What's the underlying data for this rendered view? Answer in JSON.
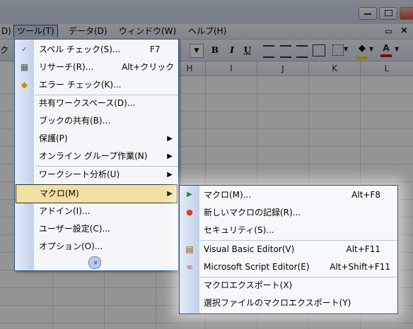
{
  "menubar": {
    "items": [
      "D)",
      "ツール(T)",
      "データ(D)",
      "ウィンドウ(W)",
      "ヘルプ(H)"
    ]
  },
  "toolbar": {
    "bold": "B",
    "italic": "I",
    "underline": "U",
    "font_color_glyph": "A"
  },
  "columns": [
    "H",
    "I",
    "J",
    "K",
    "L"
  ],
  "tools_menu": {
    "items": [
      {
        "label": "スペル チェック(S)...",
        "shortcut": "F7",
        "icon": "spellcheck-icon"
      },
      {
        "label": "リサーチ(R)...",
        "shortcut": "Alt+クリック",
        "icon": "research-icon"
      },
      {
        "label": "エラー チェック(K)...",
        "shortcut": "",
        "icon": "error-check-icon"
      },
      {
        "label": "共有ワークスペース(D)...",
        "shortcut": ""
      },
      {
        "label": "ブックの共有(B)...",
        "shortcut": ""
      },
      {
        "label": "保護(P)",
        "shortcut": "",
        "submenu": true
      },
      {
        "label": "オンライン グループ作業(N)",
        "shortcut": "",
        "submenu": true
      },
      {
        "label": "ワークシート分析(U)",
        "shortcut": "",
        "submenu": true
      },
      {
        "label": "マクロ(M)",
        "shortcut": "",
        "submenu": true
      },
      {
        "label": "アドイン(I)...",
        "shortcut": ""
      },
      {
        "label": "ユーザー設定(C)...",
        "shortcut": ""
      },
      {
        "label": "オプション(O)...",
        "shortcut": ""
      }
    ],
    "expand_glyph": "»"
  },
  "macro_submenu": {
    "items": [
      {
        "label": "マクロ(M)...",
        "shortcut": "Alt+F8",
        "icon": "play-icon"
      },
      {
        "label": "新しいマクロの記録(R)...",
        "shortcut": "",
        "icon": "record-icon"
      },
      {
        "label": "セキュリティ(S)...",
        "shortcut": ""
      },
      {
        "label": "Visual Basic Editor(V)",
        "shortcut": "Alt+F11",
        "icon": "vb-editor-icon"
      },
      {
        "label": "Microsoft Script Editor(E)",
        "shortcut": "Alt+Shift+F11",
        "icon": "script-editor-icon"
      },
      {
        "label": "マクロエクスポート(X)",
        "shortcut": ""
      },
      {
        "label": "選択ファイルのマクロエクスポート(Y)",
        "shortcut": ""
      }
    ]
  },
  "colors": {
    "highlight": "#f2dfa4",
    "menu_border": "#30508a"
  }
}
